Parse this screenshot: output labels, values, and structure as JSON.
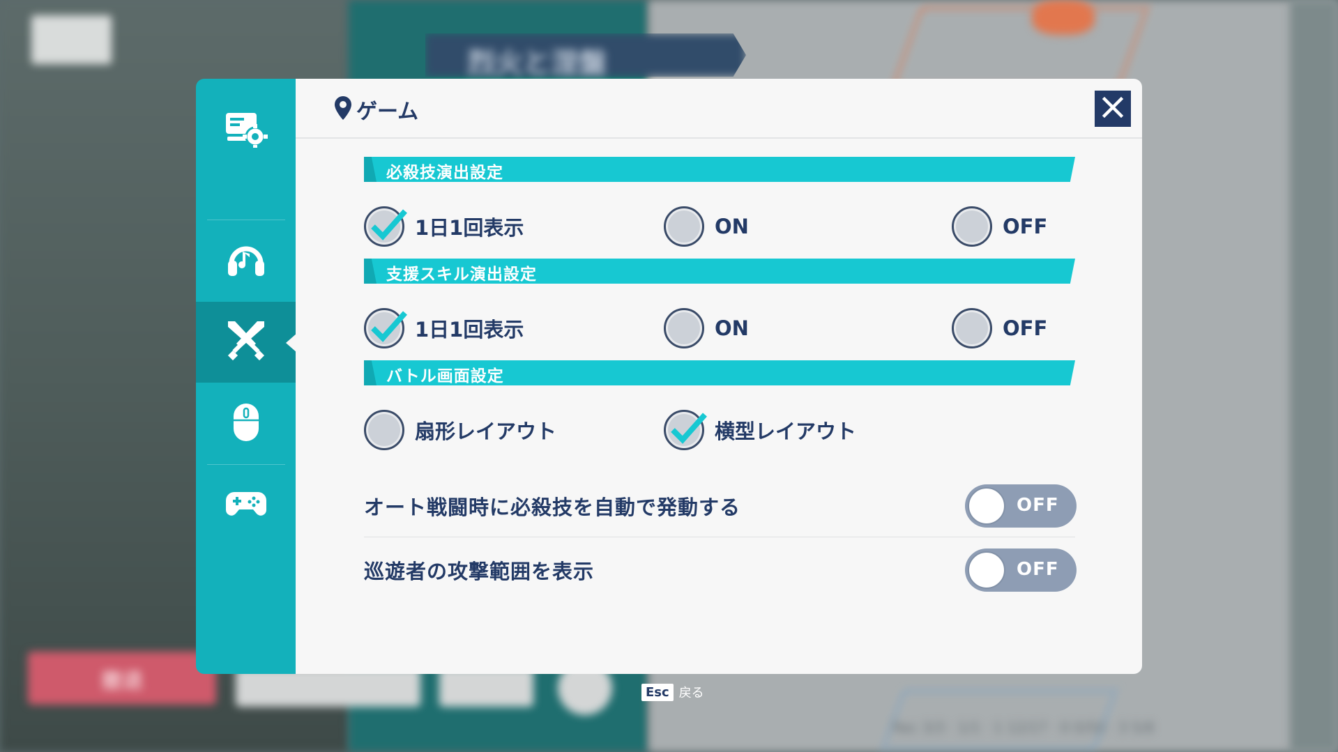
{
  "background": {
    "banner_text": "烈火と涅盤",
    "red_button": "撤退",
    "stats": "Rec 3/3 · 1/1 · 1 12/17 · 0 0/50 · 3 5/8"
  },
  "sidebar": {
    "items": [
      {
        "icon": "monitor-settings-icon",
        "active": false
      },
      {
        "icon": "headphones-icon",
        "active": false
      },
      {
        "icon": "crossed-swords-icon",
        "active": true
      },
      {
        "icon": "mouse-icon",
        "active": false
      },
      {
        "icon": "gamepad-icon",
        "active": false
      }
    ]
  },
  "panel": {
    "title": "ゲーム",
    "close_icon": "close-icon"
  },
  "sections": {
    "ultimate": {
      "label": "必殺技演出設定",
      "options": [
        {
          "label": "1日1回表示",
          "selected": true
        },
        {
          "label": "ON",
          "selected": false
        },
        {
          "label": "OFF",
          "selected": false
        }
      ]
    },
    "support": {
      "label": "支援スキル演出設定",
      "options": [
        {
          "label": "1日1回表示",
          "selected": true
        },
        {
          "label": "ON",
          "selected": false
        },
        {
          "label": "OFF",
          "selected": false
        }
      ]
    },
    "battle": {
      "label": "バトル画面設定",
      "options": [
        {
          "label": "扇形レイアウト",
          "selected": false
        },
        {
          "label": "横型レイアウト",
          "selected": true
        }
      ]
    }
  },
  "toggles": {
    "auto_ultimate": {
      "label": "オート戦闘時に必殺技を自動で発動する",
      "state": "OFF"
    },
    "attack_range": {
      "label": "巡遊者の攻撃範囲を表示",
      "state": "OFF"
    }
  },
  "footer": {
    "esc_key": "Esc",
    "esc_label": "戻る"
  },
  "colors": {
    "accent": "#17c8d2",
    "sidebar": "#13b1bb",
    "sidebar_active": "#0e8f98",
    "text": "#233a66",
    "toggle_off": "#8e9db4"
  }
}
